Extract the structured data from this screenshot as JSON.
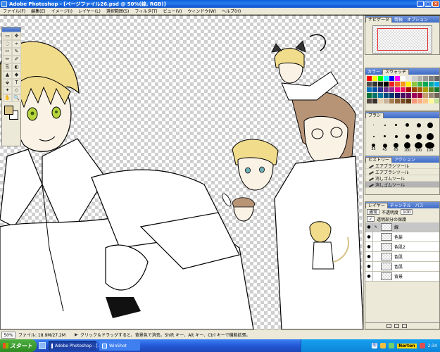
{
  "window": {
    "title": "Adobe Photoshop - [ページファイル26.psd @ 50%(線, RGB)]",
    "buttons": [
      "_",
      "□",
      "×"
    ]
  },
  "menus": [
    "ファイル(F)",
    "編集(E)",
    "イメージ(I)",
    "レイヤー(L)",
    "選択範囲(S)",
    "フィルタ(T)",
    "ビュー(V)",
    "ウィンドウ(W)",
    "ヘルプ(H)"
  ],
  "toolbox": {
    "tools": [
      "▭",
      "✥",
      "◌",
      "⌖",
      "✂",
      "✎",
      "✏",
      "✐",
      "⎘",
      "◐",
      "▲",
      "◆",
      "⬙",
      "T",
      "✦",
      "◇",
      "✋",
      "🔍"
    ],
    "colors": {
      "foreground": "#d8c285",
      "background": "#ffffff"
    }
  },
  "panels": {
    "navigator": {
      "tabs": [
        "ナビゲータ",
        "情報",
        "オプション"
      ]
    },
    "color": {
      "tabs": [
        "カラー",
        "スウォッチ"
      ],
      "swatches": [
        "#ff0000",
        "#ffff00",
        "#00ff00",
        "#00ffff",
        "#0000ff",
        "#ff00ff",
        "#ffffff",
        "#e6e6e6",
        "#cccccc",
        "#b3b3b3",
        "#999999",
        "#808080",
        "#666666",
        "#4d4d4d",
        "#333333",
        "#1a1a1a",
        "#000000",
        "#ee1d24",
        "#f26522",
        "#f7941d",
        "#fff200",
        "#8dc63f",
        "#39b54a",
        "#00a651",
        "#00a99d",
        "#00aeef",
        "#0072bc",
        "#0054a6",
        "#2e3192",
        "#662d91",
        "#92278f",
        "#ec008c",
        "#ed145b",
        "#9e0b0f",
        "#a0410d",
        "#a36209",
        "#aba000",
        "#598527",
        "#197b30",
        "#007236",
        "#00746b",
        "#0076a3",
        "#004a80",
        "#003471",
        "#1b1464",
        "#440e62",
        "#630460",
        "#9e005d",
        "#9e0039",
        "#c69c6d",
        "#998675",
        "#736357",
        "#534741",
        "#37302a",
        "#e6d1b0",
        "#c7b299",
        "#a67c52",
        "#8c6239",
        "#754c24",
        "#603913",
        "#f7977a",
        "#f9ad81",
        "#fdc68a",
        "#fff79a",
        "#c4df9b"
      ]
    },
    "brushes": {
      "tab": "ブラシ",
      "labels": [
        "",
        "",
        "",
        "",
        "",
        "",
        "",
        "",
        "",
        "",
        "",
        "",
        "35",
        "45",
        "65",
        "100",
        "100",
        "100"
      ]
    },
    "history": {
      "tabs": [
        "ヒストリー",
        "アクション"
      ],
      "items": [
        "エアブラシツール",
        "エアブラシツール",
        "消しゴムツール",
        "消しゴムツール"
      ]
    },
    "layers": {
      "tabs": [
        "レイヤー",
        "チャンネル",
        "パス"
      ],
      "blend_mode": "通常",
      "opacity_label": "不透明度",
      "opacity_value": "100",
      "preserve_label": "透明部分の保護",
      "items": [
        "線",
        "色髪",
        "色肌2",
        "色肌",
        "色肌",
        "背景"
      ]
    }
  },
  "statusbar": {
    "zoom": "50%",
    "doc_size": "ファイル: 18.9M/27.2M",
    "hint": "クリック＆ドラッグすると、背景色で消去。Shift キー、Alt キー、Ctrl キーで機能拡張。"
  },
  "taskbar": {
    "start_label": "スタート",
    "tasks": [
      "Adobe Photoshop - [...",
      "WinShot"
    ],
    "tray": {
      "norton_label": "Norton",
      "clock": "2:34",
      "ime_label": "般"
    }
  },
  "accent_colors": {
    "titlebar": "#0a5fd8",
    "taskbar": "#2458d6",
    "start": "#3a9a30"
  }
}
